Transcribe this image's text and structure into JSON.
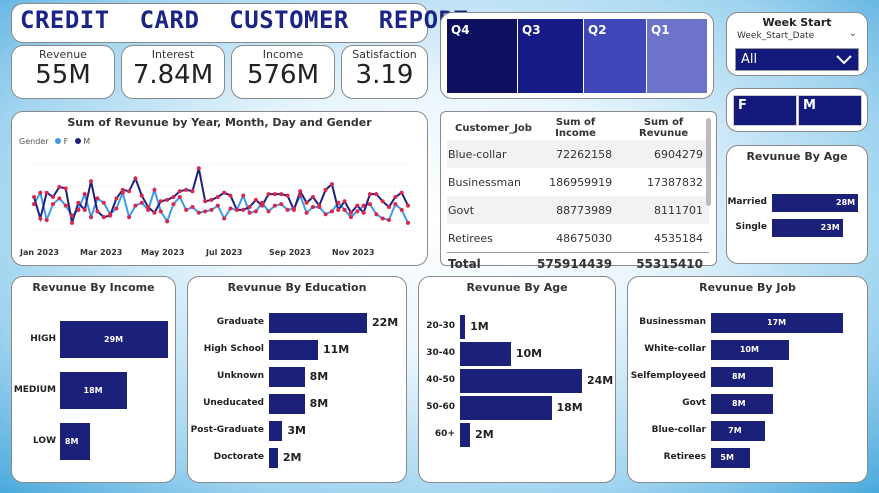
{
  "title": "CREDIT  CARD  CUSTOMER  REPORT",
  "kpis": [
    {
      "label": "Revenue",
      "value": "55M"
    },
    {
      "label": "Interest",
      "value": "7.84M"
    },
    {
      "label": "Income",
      "value": "576M"
    },
    {
      "label": "Satisfaction",
      "value": "3.19"
    }
  ],
  "quarters": [
    "Q4",
    "Q3",
    "Q2",
    "Q1"
  ],
  "quarter_colors": [
    "#0d0f5e",
    "#151a86",
    "#3f47b8",
    "#6c73c8"
  ],
  "week_start": {
    "title": "Week Start",
    "field": "Week_Start_Date",
    "value": "All"
  },
  "gender_slicer": [
    "F",
    "M"
  ],
  "table": {
    "headers": [
      "Customer_Job",
      "Sum of Income",
      "Sum of Revunue"
    ],
    "rows": [
      [
        "Blue-collar",
        "72262158",
        "6904279"
      ],
      [
        "Businessman",
        "186959919",
        "17387832"
      ],
      [
        "Govt",
        "88773989",
        "8111701"
      ],
      [
        "Retirees",
        "48675030",
        "4535184"
      ]
    ],
    "total": [
      "Total",
      "575914439",
      "55315410"
    ]
  },
  "chart_data": [
    {
      "type": "line",
      "title": "Sum of Revunue by Year, Month, Day and Gender",
      "legend_title": "Gender",
      "x_ticks": [
        "Jan 2023",
        "Mar 2023",
        "May 2023",
        "Jul 2023",
        "Sep 2023",
        "Nov 2023"
      ],
      "legend_position": "top-left",
      "series": [
        {
          "name": "F",
          "color": "#3f9be8",
          "values": [
            108,
            116,
            97,
            108,
            112,
            107,
            100,
            104,
            115,
            99,
            112,
            109,
            101,
            105,
            116,
            99,
            107,
            109,
            104,
            118,
            103,
            96,
            108,
            113,
            104,
            106,
            102,
            103,
            104,
            107,
            98,
            105,
            104,
            114,
            102,
            103,
            109,
            103,
            107,
            108,
            104,
            105,
            114,
            102,
            106,
            106,
            101,
            103,
            109,
            104,
            99,
            103,
            107,
            108,
            101,
            98,
            97,
            108,
            104,
            95
          ]
        },
        {
          "name": "M",
          "color": "#1e2080",
          "values": [
            113,
            98,
            116,
            113,
            120,
            119,
            95,
            109,
            104,
            124,
            103,
            99,
            100,
            112,
            118,
            117,
            126,
            114,
            106,
            102,
            110,
            111,
            113,
            117,
            118,
            117,
            133,
            110,
            111,
            113,
            116,
            114,
            104,
            104,
            106,
            111,
            107,
            115,
            115,
            115,
            114,
            104,
            117,
            109,
            113,
            107,
            118,
            122,
            104,
            110,
            102,
            107,
            102,
            115,
            115,
            110,
            106,
            113,
            116,
            107
          ]
        }
      ]
    },
    {
      "type": "bar",
      "title": "Revunue By Age",
      "categories": [
        "Married",
        "Single"
      ],
      "values": [
        28,
        23
      ],
      "labels": [
        "28M",
        "23M"
      ]
    },
    {
      "type": "bar",
      "title": "Revunue By Income",
      "categories": [
        "HIGH",
        "MEDIUM",
        "LOW"
      ],
      "values": [
        29,
        18,
        8
      ],
      "labels": [
        "29M",
        "18M",
        "8M"
      ]
    },
    {
      "type": "bar",
      "title": "Revunue By Education",
      "categories": [
        "Graduate",
        "High School",
        "Unknown",
        "Uneducated",
        "Post-Graduate",
        "Doctorate"
      ],
      "values": [
        22,
        11,
        8,
        8,
        3,
        2
      ],
      "labels": [
        "22M",
        "11M",
        "8M",
        "8M",
        "3M",
        "2M"
      ]
    },
    {
      "type": "bar",
      "title": "Revunue By Age",
      "categories": [
        "20-30",
        "30-40",
        "40-50",
        "50-60",
        "60+"
      ],
      "values": [
        1,
        10,
        24,
        18,
        2
      ],
      "labels": [
        "1M",
        "10M",
        "24M",
        "18M",
        "2M"
      ]
    },
    {
      "type": "bar",
      "title": "Revunue By Job",
      "categories": [
        "Businessman",
        "White-collar",
        "Selfemployeed",
        "Govt",
        "Blue-collar",
        "Retirees"
      ],
      "values": [
        17,
        10,
        8,
        8,
        7,
        5
      ],
      "labels": [
        "17M",
        "10M",
        "8M",
        "8M",
        "7M",
        "5M"
      ]
    }
  ]
}
